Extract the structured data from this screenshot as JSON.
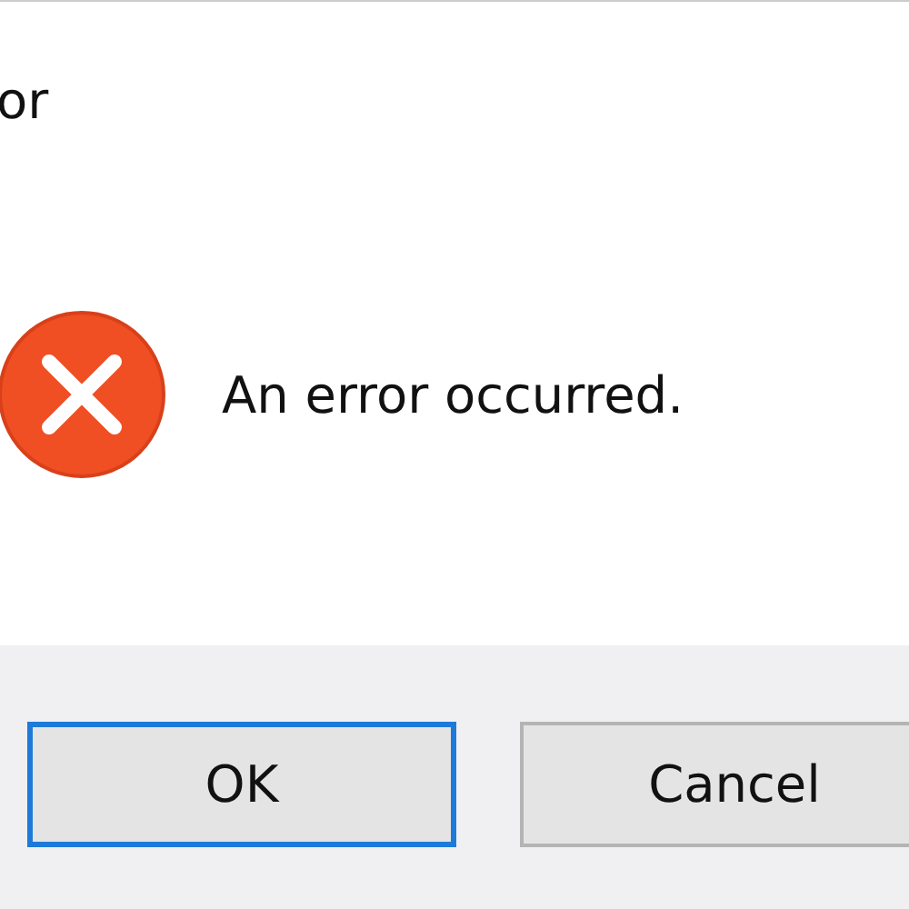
{
  "window": {
    "title": "or"
  },
  "message": {
    "text": "An error occurred."
  },
  "buttons": [
    {
      "label": "OK",
      "selected": true
    },
    {
      "label": "Cancel",
      "selected": false
    }
  ]
}
